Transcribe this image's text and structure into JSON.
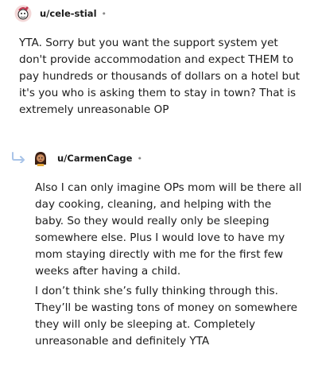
{
  "comments": [
    {
      "username": "u/cele-stial",
      "separator": "•",
      "paragraphs": [
        "YTA. Sorry but you want the support system yet don't provide accommodation and expect THEM to pay hundreds or thousands of dollars on a hotel but it's you who is asking them to stay in town? That is extremely unreasonable OP"
      ]
    },
    {
      "username": "u/CarmenCage",
      "separator": "•",
      "paragraphs": [
        "Also I can only imagine OPs mom will be there all day cooking, cleaning, and helping with the baby. So they would really only be sleeping somewhere else. Plus I would love to have my mom staying directly with me for the first few weeks after having a child.",
        "I don’t think she’s fully thinking through this. They’ll be wasting tons of money on somewhere they will only be sleeping at. Completely unreasonable and definitely YTA"
      ]
    }
  ],
  "icons": {
    "avatar_1": "snoo-avatar-icon",
    "avatar_2": "user-avatar-icon",
    "reply": "reply-arrow-icon"
  },
  "colors": {
    "text": "#1c1c1c",
    "muted": "#8a8a8a",
    "reply_arrow": "#a9c4e8"
  }
}
